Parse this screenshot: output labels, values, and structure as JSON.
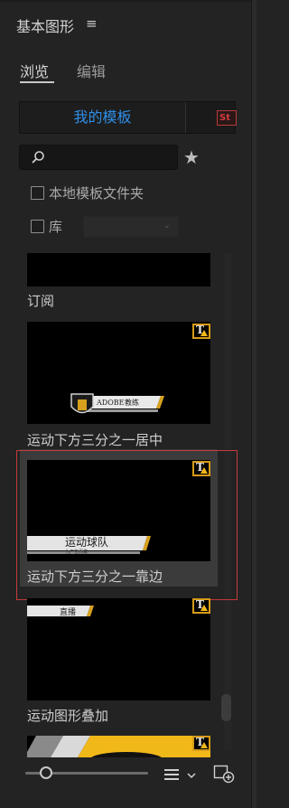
{
  "panel": {
    "title": "基本图形",
    "menu_icon": "hamburger-menu-icon"
  },
  "tabs": [
    {
      "label": "浏览",
      "active": true
    },
    {
      "label": "编辑",
      "active": false
    }
  ],
  "source_toggle": {
    "my_templates": "我的模板",
    "adobe_stock_badge": "St"
  },
  "search": {
    "placeholder": "",
    "icon": "search-icon"
  },
  "favorites_icon": "star-icon",
  "filters": {
    "local_templates_folder": {
      "label": "本地模板文件夹",
      "checked": false
    },
    "library": {
      "label": "库",
      "checked": false,
      "selected": ""
    }
  },
  "templates": [
    {
      "name": "订阅"
    },
    {
      "name": "运动下方三分之一居中",
      "caption_line1": "ADOBE",
      "caption_line2": "教练"
    },
    {
      "name": "运动下方三分之一靠边",
      "caption_line1": "运动球队",
      "caption_line2": "为广告而做",
      "selected": true
    },
    {
      "name": "运动图形叠加",
      "caption_line1": "直播"
    }
  ],
  "colors": {
    "accent_blue": "#2f8fe8",
    "warning_yellow": "#d79b18",
    "selection_red": "#c63a3a",
    "stock_red": "#d13c3c"
  },
  "bottom": {
    "zoom_slider": 0.12,
    "sort_icon": "sort-list-icon",
    "new_item_icon": "new-item-icon"
  }
}
